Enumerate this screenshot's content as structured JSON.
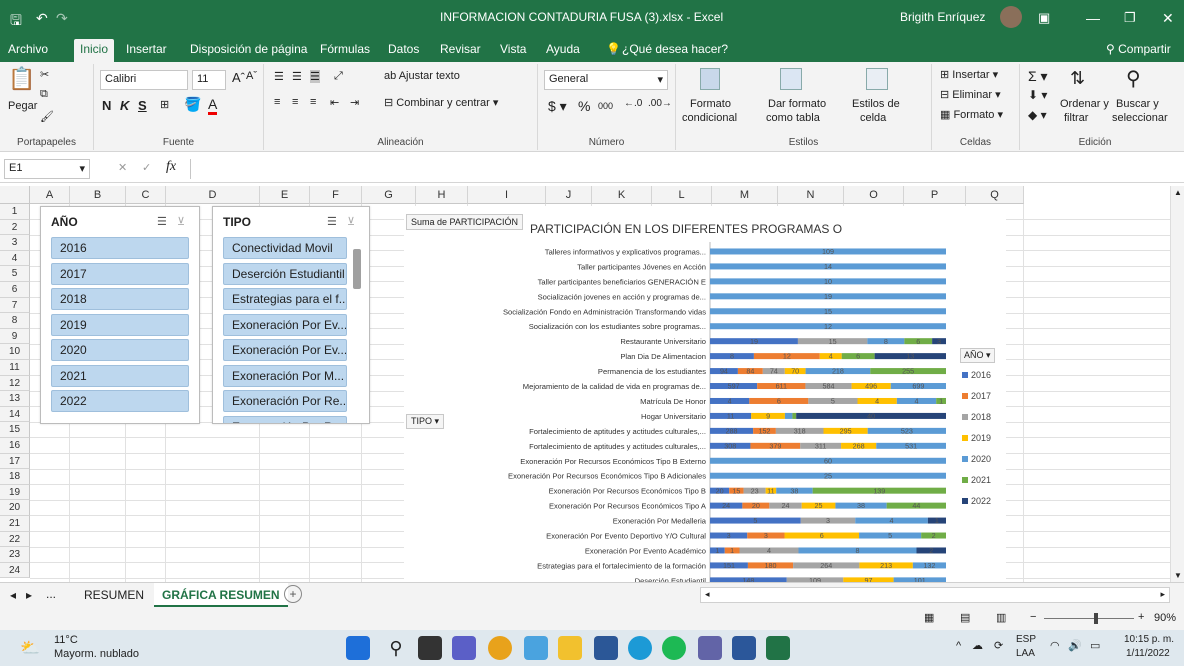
{
  "window": {
    "title": "INFORMACION CONTADURIA FUSA (3).xlsx  -  Excel",
    "user": "Brigith Enríquez"
  },
  "tabs": [
    "Archivo",
    "Inicio",
    "Insertar",
    "Disposición de página",
    "Fórmulas",
    "Datos",
    "Revisar",
    "Vista",
    "Ayuda"
  ],
  "tell_me": "¿Qué desea hacer?",
  "share": "Compartir",
  "ribbon": {
    "paste": "Pegar",
    "font_name": "Calibri",
    "font_size": "11",
    "bold": "N",
    "italic": "K",
    "underline": "S",
    "wrap": "Ajustar texto",
    "merge": "Combinar y centrar",
    "number_format": "General",
    "percent": "%",
    "thousands": "000",
    "cond_format": "Formato",
    "cond_format2": "condicional",
    "format_table": "Dar formato",
    "format_table2": "como tabla",
    "cell_styles": "Estilos de",
    "cell_styles2": "celda",
    "insert": "Insertar",
    "delete": "Eliminar",
    "format": "Formato",
    "sort": "Ordenar y",
    "sort2": "filtrar",
    "find": "Buscar y",
    "find2": "seleccionar",
    "groups": [
      "Portapapeles",
      "Fuente",
      "Alineación",
      "Número",
      "Estilos",
      "Celdas",
      "Edición"
    ]
  },
  "formula_bar": {
    "cell_ref": "E1",
    "fx": "fx",
    "value": ""
  },
  "columns": [
    "A",
    "B",
    "C",
    "D",
    "E",
    "F",
    "G",
    "H",
    "I",
    "J",
    "K",
    "L",
    "M",
    "N",
    "O",
    "P",
    "Q"
  ],
  "rows": [
    "1",
    "2",
    "3",
    "4",
    "5",
    "6",
    "7",
    "8",
    "9",
    "10",
    "11",
    "12",
    "13",
    "14",
    "15",
    "16",
    "17",
    "18",
    "19",
    "20",
    "21",
    "22",
    "23",
    "24"
  ],
  "slicer_year": {
    "header": "AÑO",
    "items": [
      "2016",
      "2017",
      "2018",
      "2019",
      "2020",
      "2021",
      "2022"
    ]
  },
  "slicer_type": {
    "header": "TIPO",
    "items": [
      "Conectividad Movil",
      "Deserción Estudiantil",
      "Estrategias para el f...",
      "Exoneración Por Ev...",
      "Exoneración Por Ev...",
      "Exoneración Por M...",
      "Exoneración Por Re...",
      "Exoneración Por Re..."
    ]
  },
  "pivot_field_button": "Suma de PARTICIPACIÓN",
  "tipo_button": "TIPO",
  "legend_button": "AÑO",
  "sheets": {
    "nav": "...",
    "tabs": [
      "RESUMEN",
      "GRÁFICA RESUMEN"
    ],
    "add": "+"
  },
  "status": {
    "zoom": "90%"
  },
  "taskbar": {
    "temp": "11°C",
    "weather": "Mayorm. nublado",
    "lang1": "ESP",
    "lang2": "LAA",
    "time": "10:15 p. m.",
    "date": "1/11/2022"
  },
  "colors": {
    "2016": "#4472c4",
    "2017": "#ed7d31",
    "2018": "#a5a5a5",
    "2019": "#ffc000",
    "2020": "#5b9bd5",
    "2021": "#70ad47",
    "2022": "#264478"
  },
  "chart_data": {
    "type": "bar",
    "orientation": "horizontal",
    "stacked": true,
    "title": "PARTICIPACIÓN EN LOS DIFERENTES PROGRAMAS O",
    "legend_position": "right",
    "categories": [
      "Talleres informativos y explicativos programas...",
      "Taller participantes Jóvenes en Acción",
      "Taller participantes beneficiarios GENERACIÓN E",
      "Socialización jovenes en acción y programas de...",
      "Socialización Fondo en Administración Transformando vidas",
      "Socialización con los estudiantes sobre programas...",
      "Restaurante Universitario",
      "Plan Dia De Alimentacion",
      "Permanencia de los estudiantes",
      "Mejoramiento de la calidad de vida en programas de...",
      "Matrícula De Honor",
      "Hogar Universitario",
      "Fortalecimiento de aptitudes y actitudes culturales,...",
      "Fortalecimiento de aptitudes y actitudes culturales,...",
      "Exoneración Por Recursos Económicos Tipo B  Externo",
      "Exoneración Por Recursos Económicos Tipo B  Adicionales",
      "Exoneración Por Recursos Económicos Tipo B",
      "Exoneración Por Recursos Económicos Tipo A",
      "Exoneración Por Medalleria",
      "Exoneración Por Evento Deportivo Y/O Cultural",
      "Exoneración Por Evento Académico",
      "Estrategias para el fortalecimiento de la formación",
      "Deserción Estudiantil"
    ],
    "series": [
      {
        "name": "2016",
        "values": [
          0,
          0,
          0,
          0,
          0,
          0,
          19,
          8,
          94,
          597,
          4,
          11,
          288,
          308,
          0,
          0,
          20,
          24,
          5,
          3,
          1,
          151,
          148
        ]
      },
      {
        "name": "2017",
        "values": [
          0,
          0,
          0,
          0,
          0,
          0,
          0,
          12,
          84,
          611,
          6,
          0,
          152,
          379,
          0,
          0,
          15,
          20,
          0,
          3,
          1,
          180,
          0
        ]
      },
      {
        "name": "2018",
        "values": [
          0,
          0,
          0,
          0,
          0,
          0,
          15,
          0,
          74,
          584,
          5,
          0,
          318,
          311,
          0,
          0,
          23,
          24,
          3,
          0,
          4,
          264,
          109
        ]
      },
      {
        "name": "2019",
        "values": [
          0,
          0,
          0,
          0,
          0,
          0,
          0,
          4,
          70,
          496,
          4,
          9,
          295,
          268,
          0,
          0,
          11,
          25,
          0,
          6,
          0,
          213,
          97
        ]
      },
      {
        "name": "2020",
        "values": [
          109,
          14,
          10,
          19,
          15,
          12,
          8,
          0,
          218,
          699,
          4,
          2,
          523,
          531,
          60,
          25,
          38,
          38,
          4,
          5,
          8,
          132,
          101
        ]
      },
      {
        "name": "2021",
        "values": [
          0,
          0,
          0,
          0,
          0,
          0,
          6,
          6,
          255,
          0,
          1,
          1,
          0,
          0,
          0,
          0,
          139,
          44,
          0,
          2,
          0,
          0,
          0
        ]
      },
      {
        "name": "2022",
        "values": [
          0,
          0,
          0,
          0,
          0,
          0,
          3,
          13,
          0,
          0,
          0,
          40,
          0,
          0,
          0,
          0,
          0,
          0,
          1,
          0,
          2,
          0,
          0
        ]
      }
    ]
  }
}
